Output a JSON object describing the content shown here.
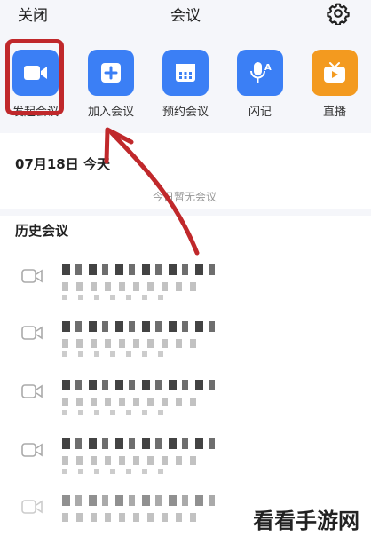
{
  "header": {
    "close_label": "关闭",
    "title": "会议",
    "settings_icon": "gear-icon"
  },
  "quick_actions": [
    {
      "label": "发起会议",
      "icon": "video-camera-icon",
      "color": "#3b7ff5"
    },
    {
      "label": "加入会议",
      "icon": "plus-icon",
      "color": "#3b7ff5"
    },
    {
      "label": "预约会议",
      "icon": "calendar-icon",
      "color": "#3b7ff5"
    },
    {
      "label": "闪记",
      "icon": "microphone-icon",
      "color": "#3b7ff5"
    },
    {
      "label": "直播",
      "icon": "tv-play-icon",
      "color": "#f39a1f"
    }
  ],
  "today": {
    "date_label": "07月18日 今天",
    "empty_text": "今日暂无会议"
  },
  "history": {
    "title": "历史会议",
    "items": [
      {
        "icon": "video-camera-icon"
      },
      {
        "icon": "video-camera-icon"
      },
      {
        "icon": "video-camera-icon"
      },
      {
        "icon": "video-camera-icon"
      },
      {
        "icon": "video-camera-icon"
      }
    ]
  },
  "watermark": "看看手游网",
  "colors": {
    "accent": "#3b7ff5",
    "live": "#f39a1f",
    "annotation": "#c0282b"
  }
}
